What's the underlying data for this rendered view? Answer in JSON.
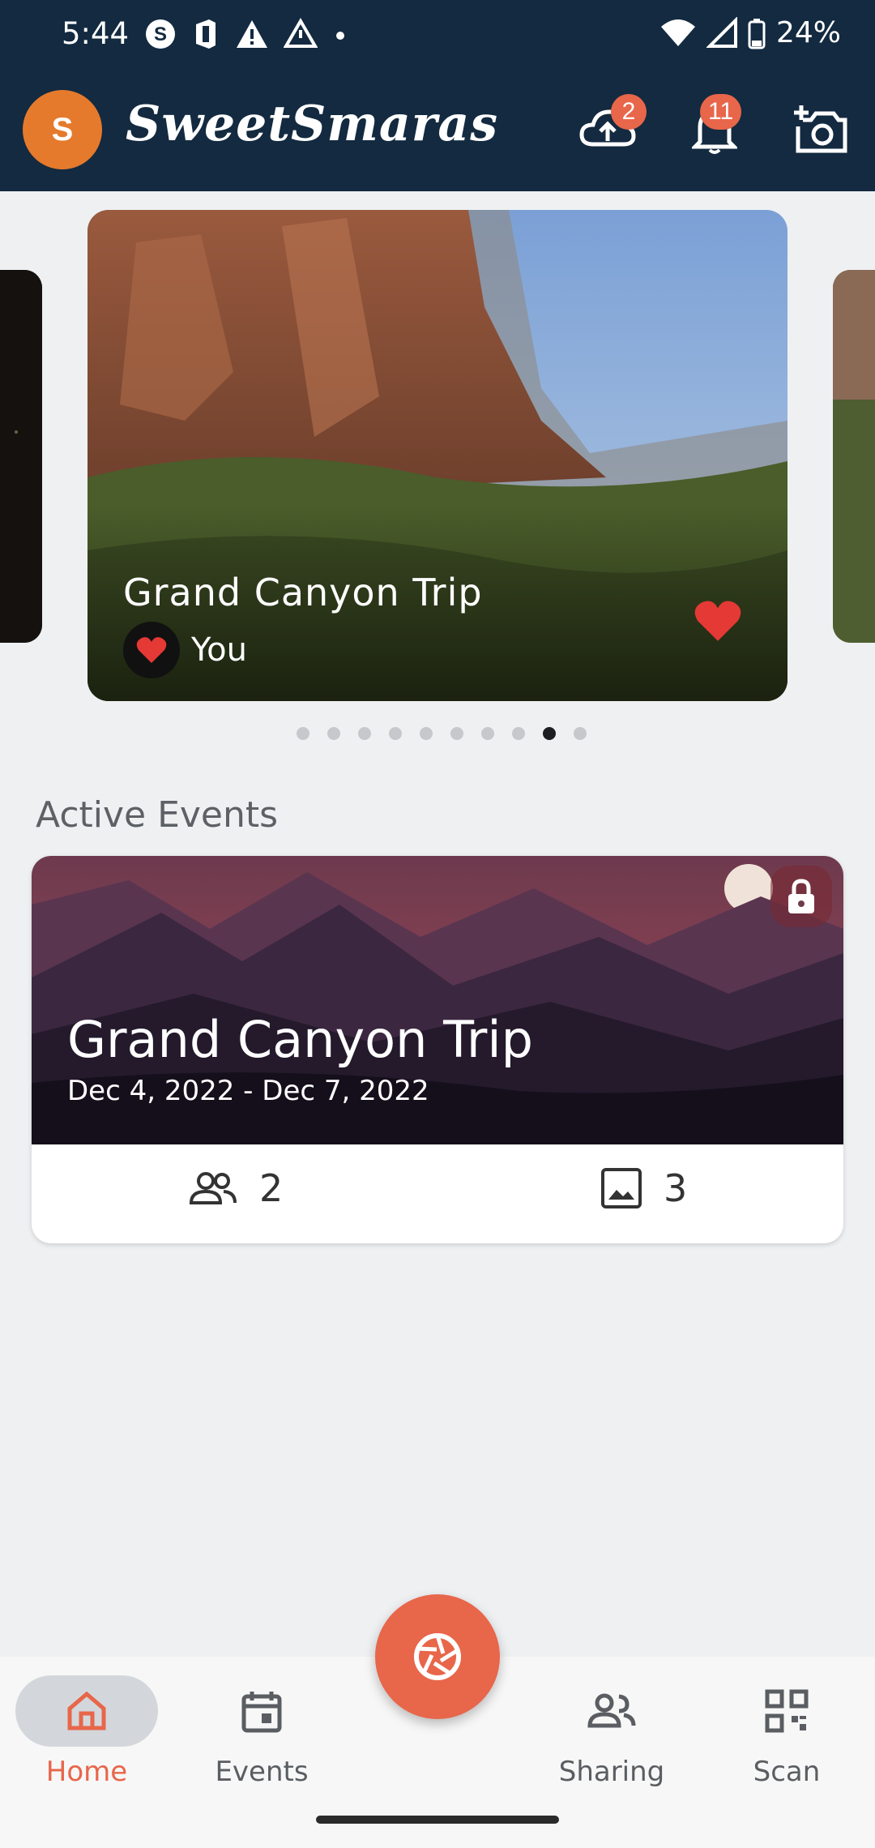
{
  "status_bar": {
    "time": "5:44",
    "battery": "24%"
  },
  "header": {
    "avatar_letter": "S",
    "brand": "SweetSmaras",
    "upload_badge": "2",
    "notifications_badge": "11"
  },
  "carousel": {
    "card_title": "Grand Canyon Trip",
    "owner": "You",
    "dots_total": 10,
    "active_dot": 8
  },
  "active_events": {
    "section_title": "Active Events",
    "event": {
      "title": "Grand Canyon Trip",
      "dates": "Dec 4, 2022 - Dec 7, 2022",
      "members": "2",
      "photos": "3"
    }
  },
  "bottom_nav": {
    "home": "Home",
    "events": "Events",
    "sharing": "Sharing",
    "scan": "Scan"
  },
  "colors": {
    "header_bg": "#132a40",
    "accent": "#e8664a",
    "avatar": "#e57a2c"
  }
}
